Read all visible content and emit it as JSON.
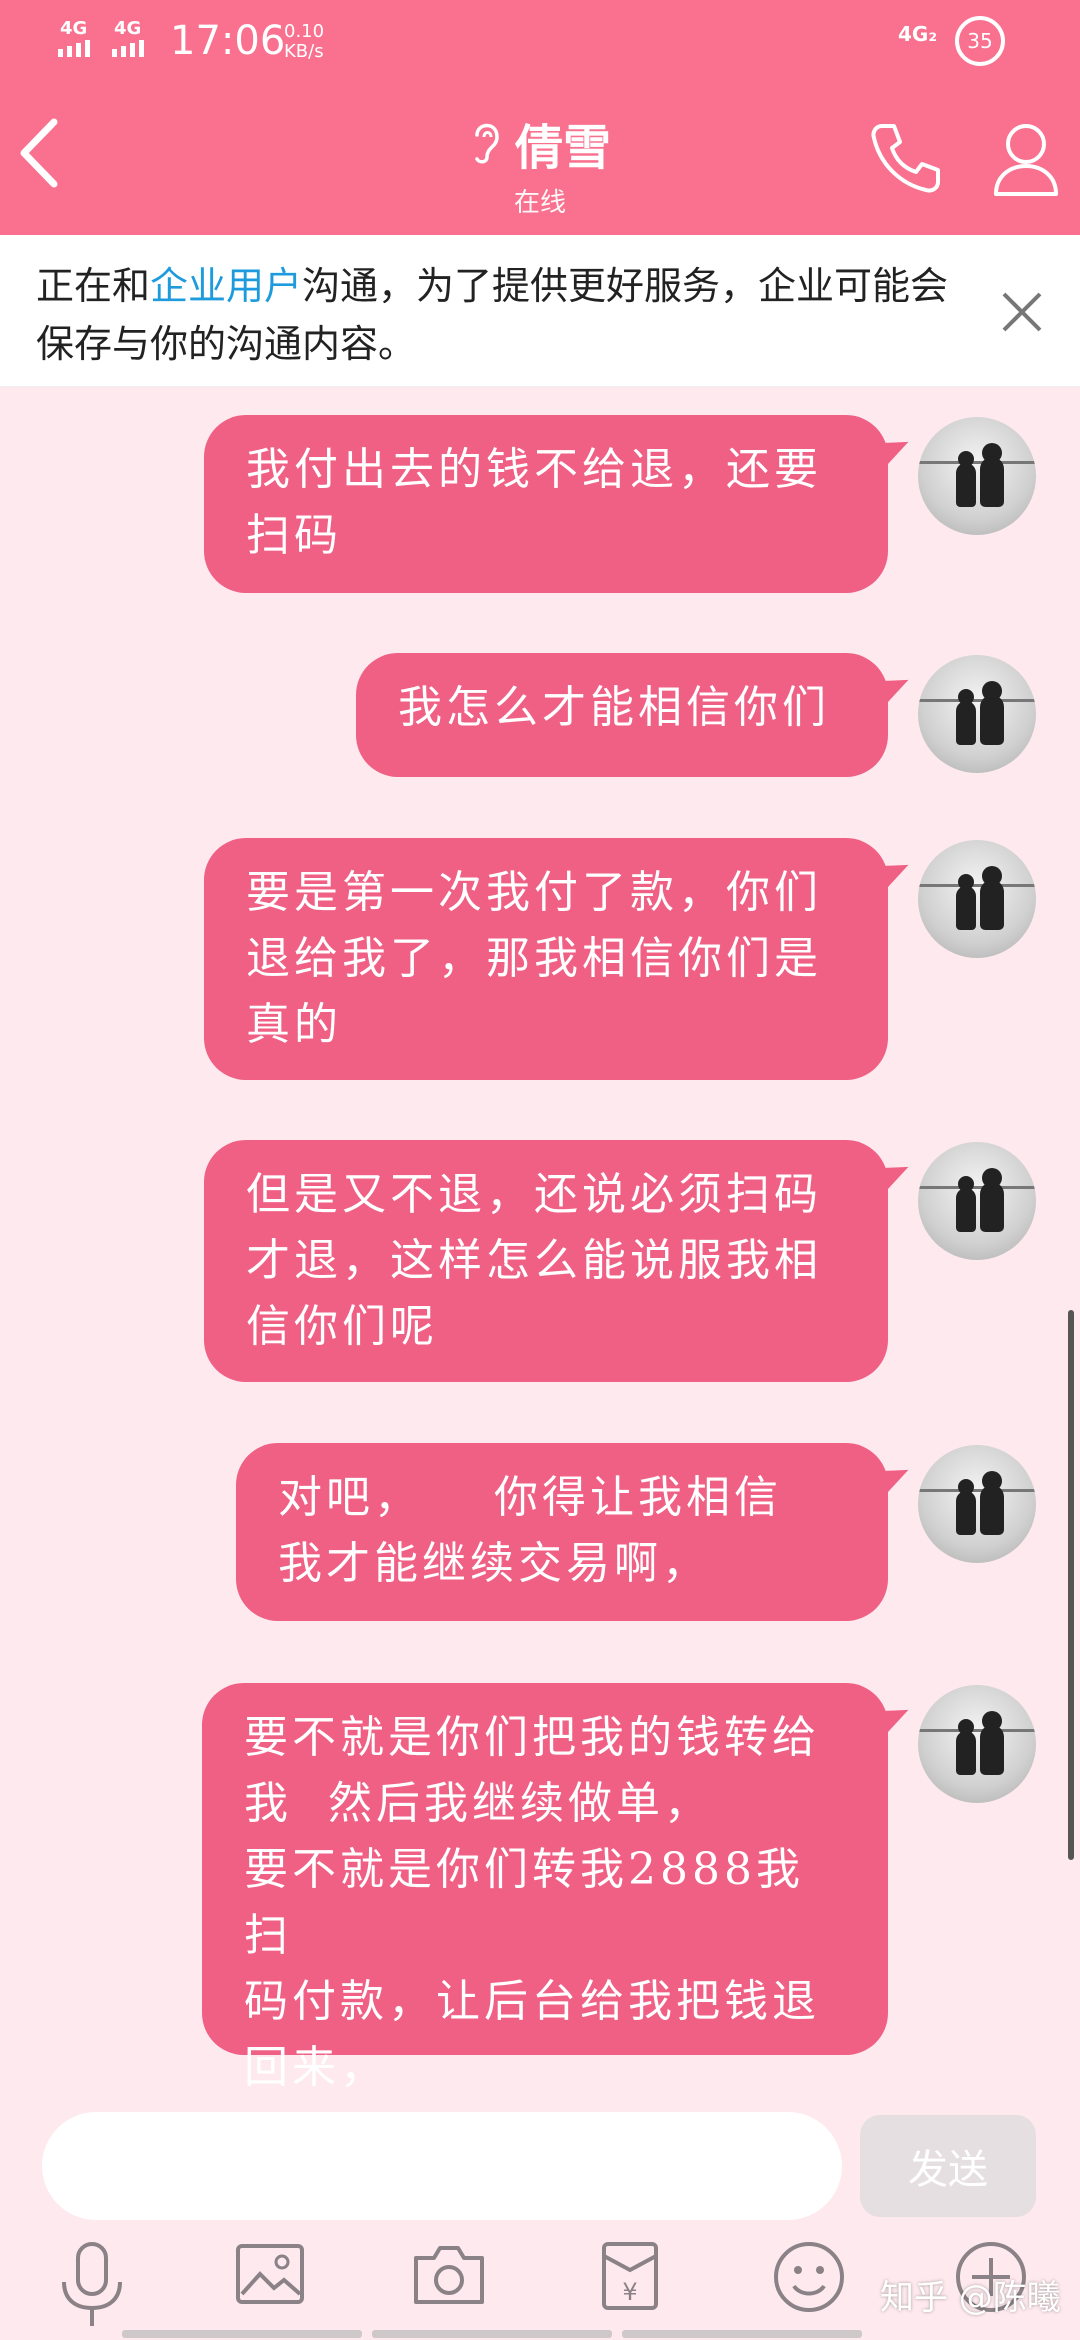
{
  "status_bar": {
    "network_1": "4G",
    "network_2": "4G",
    "time": "17:06",
    "speed_value": "0.10",
    "speed_unit": "KB/s",
    "network_right": "4G₂",
    "battery": "35"
  },
  "header": {
    "title": "倩雪",
    "subtitle": "在线",
    "icons": [
      "back-arrow-icon",
      "ear-icon",
      "phone-icon",
      "profile-icon"
    ]
  },
  "notice": {
    "before": "正在和",
    "link": "企业用户",
    "after": "沟通，为了提供更好服务，企业可能会保存与你的沟通内容。",
    "close_icon": "close-icon"
  },
  "messages": [
    {
      "text": "我付出去的钱不给退，还要\n扫码"
    },
    {
      "text": "我怎么才能相信你们"
    },
    {
      "text": "要是第一次我付了款，你们\n退给我了，那我相信你们是\n真的"
    },
    {
      "text": "但是又不退，还说必须扫码\n才退，这样怎么能说服我相\n信你们呢"
    },
    {
      "text": "对吧，    你得让我相信\n我才能继续交易啊，"
    },
    {
      "text": "要不就是你们把我的钱转给\n我  然后我继续做单，\n要不就是你们转我2888我扫\n码付款，让后台给我把钱退\n回来，"
    }
  ],
  "composer": {
    "input_value": "",
    "send_label": "发送"
  },
  "toolbar": [
    "microphone-icon",
    "image-icon",
    "camera-icon",
    "red-packet-icon",
    "emoji-icon",
    "plus-icon"
  ],
  "watermark": "知乎 @陈曦",
  "colors": {
    "header": "#f9718e",
    "bubble": "#f05f84",
    "background": "#fde9ee",
    "link": "#1e9bdc"
  }
}
